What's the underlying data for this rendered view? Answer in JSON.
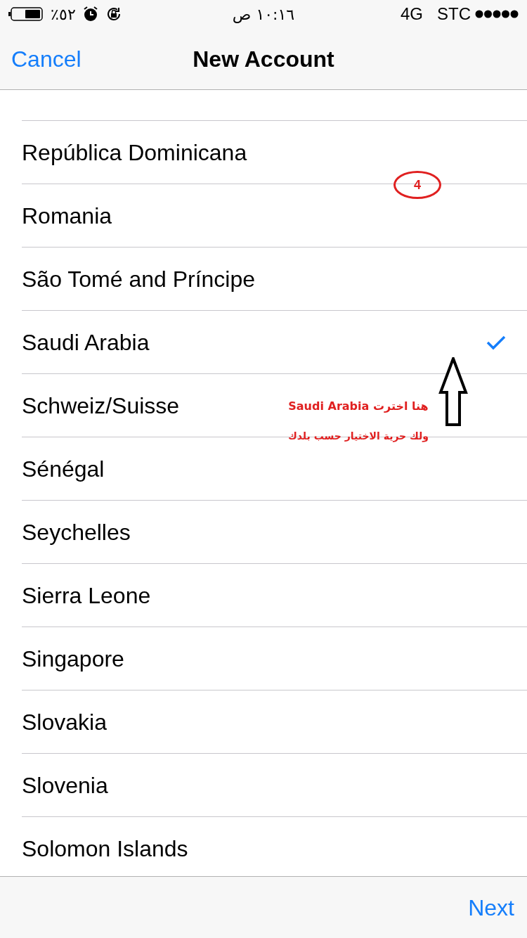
{
  "status_bar": {
    "battery": "٪٥٢",
    "time": "١٠:١٦ ص",
    "network": "4G",
    "carrier": "STC"
  },
  "nav": {
    "cancel": "Cancel",
    "title": "New Account"
  },
  "countries": [
    {
      "name": "República Dominicana",
      "selected": false
    },
    {
      "name": "Romania",
      "selected": false
    },
    {
      "name": "São Tomé and Príncipe",
      "selected": false
    },
    {
      "name": "Saudi Arabia",
      "selected": true
    },
    {
      "name": "Schweiz/Suisse",
      "selected": false
    },
    {
      "name": "Sénégal",
      "selected": false
    },
    {
      "name": "Seychelles",
      "selected": false
    },
    {
      "name": "Sierra Leone",
      "selected": false
    },
    {
      "name": "Singapore",
      "selected": false
    },
    {
      "name": "Slovakia",
      "selected": false
    },
    {
      "name": "Slovenia",
      "selected": false
    },
    {
      "name": "Solomon Islands",
      "selected": false
    }
  ],
  "annotations": {
    "step": "4",
    "line_1": "هنا اخترت Saudi Arabia",
    "line_2": "ولك حرية الاختيار حسب بلدك"
  },
  "toolbar": {
    "next": "Next"
  }
}
